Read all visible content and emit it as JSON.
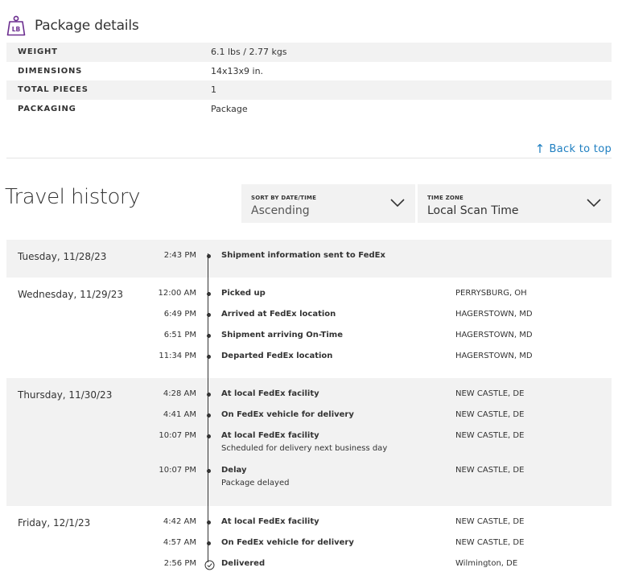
{
  "package": {
    "title": "Package details",
    "icon_text": "LB",
    "rows": [
      {
        "key": "WEIGHT",
        "value": "6.1 lbs / 2.77 kgs"
      },
      {
        "key": "DIMENSIONS",
        "value": "14x13x9 in."
      },
      {
        "key": "TOTAL PIECES",
        "value": "1"
      },
      {
        "key": "PACKAGING",
        "value": "Package"
      }
    ]
  },
  "back_to_top": {
    "arrow": "↑",
    "label": "Back to top"
  },
  "travel": {
    "title": "Travel history",
    "sort": {
      "label": "SORT BY DATE/TIME",
      "value": "Ascending"
    },
    "timezone": {
      "label": "TIME ZONE",
      "value": "Local Scan Time"
    },
    "days": [
      {
        "date": "Tuesday, 11/28/23",
        "events": [
          {
            "time": "2:43 PM",
            "desc": "Shipment information sent to FedEx",
            "sub": "",
            "loc": ""
          }
        ]
      },
      {
        "date": "Wednesday, 11/29/23",
        "events": [
          {
            "time": "12:00 AM",
            "desc": "Picked up",
            "sub": "",
            "loc": "PERRYSBURG, OH"
          },
          {
            "time": "6:49 PM",
            "desc": "Arrived at FedEx location",
            "sub": "",
            "loc": "HAGERSTOWN, MD"
          },
          {
            "time": "6:51 PM",
            "desc": "Shipment arriving On-Time",
            "sub": "",
            "loc": "HAGERSTOWN, MD"
          },
          {
            "time": "11:34 PM",
            "desc": "Departed FedEx location",
            "sub": "",
            "loc": "HAGERSTOWN, MD"
          }
        ]
      },
      {
        "date": "Thursday, 11/30/23",
        "events": [
          {
            "time": "4:28 AM",
            "desc": "At local FedEx facility",
            "sub": "",
            "loc": "NEW CASTLE, DE"
          },
          {
            "time": "4:41 AM",
            "desc": "On FedEx vehicle for delivery",
            "sub": "",
            "loc": "NEW CASTLE, DE"
          },
          {
            "time": "10:07 PM",
            "desc": "At local FedEx facility",
            "sub": "Scheduled for delivery next business day",
            "loc": "NEW CASTLE, DE"
          },
          {
            "time": "10:07 PM",
            "desc": "Delay",
            "sub": "Package delayed",
            "loc": "NEW CASTLE, DE"
          }
        ]
      },
      {
        "date": "Friday, 12/1/23",
        "events": [
          {
            "time": "4:42 AM",
            "desc": "At local FedEx facility",
            "sub": "",
            "loc": "NEW CASTLE, DE"
          },
          {
            "time": "4:57 AM",
            "desc": "On FedEx vehicle for delivery",
            "sub": "",
            "loc": "NEW CASTLE, DE"
          },
          {
            "time": "2:56 PM",
            "desc": "Delivered",
            "sub": "",
            "loc": "Wilmington, DE"
          }
        ]
      }
    ]
  },
  "colors": {
    "link": "#1f7fc1",
    "icon": "#6b2d8f",
    "shade": "#f2f2f2"
  },
  "icons": {
    "weight": "weight-lb-icon",
    "sort_chevron": "chevron-down-icon",
    "tz_chevron": "chevron-down-icon",
    "delivered": "check-circle-icon"
  }
}
